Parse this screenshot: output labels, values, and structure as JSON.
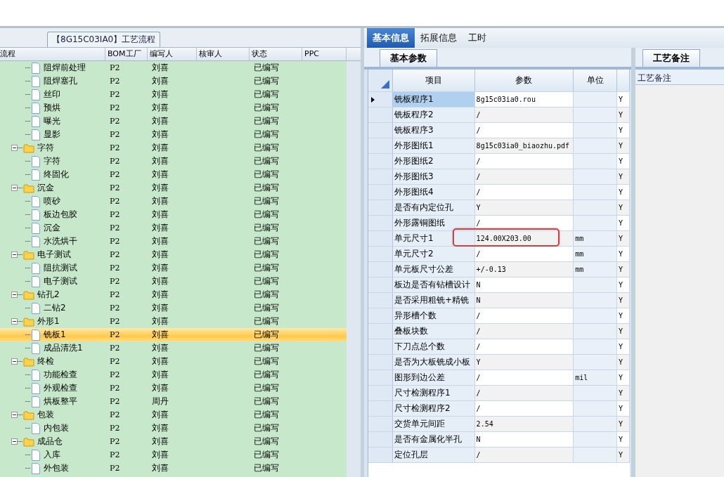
{
  "left_panel": {
    "title": "【8G15C03IA0】工艺流程",
    "columns": [
      "流程",
      "BOM工厂",
      "编写人",
      "核审人",
      "状态",
      "PPC"
    ],
    "rows": [
      {
        "kind": "step",
        "name": "阻焊前处理",
        "bom": "P2",
        "writer": "刘喜",
        "status": "已编写",
        "selected": false
      },
      {
        "kind": "step",
        "name": "阻焊塞孔",
        "bom": "P2",
        "writer": "刘喜",
        "status": "已编写",
        "selected": false
      },
      {
        "kind": "step",
        "name": "丝印",
        "bom": "P2",
        "writer": "刘喜",
        "status": "已编写",
        "selected": false
      },
      {
        "kind": "step",
        "name": "预烘",
        "bom": "P2",
        "writer": "刘喜",
        "status": "已编写",
        "selected": false
      },
      {
        "kind": "step",
        "name": "曝光",
        "bom": "P2",
        "writer": "刘喜",
        "status": "已编写",
        "selected": false
      },
      {
        "kind": "step",
        "name": "显影",
        "bom": "P2",
        "writer": "刘喜",
        "status": "已编写",
        "selected": false
      },
      {
        "kind": "group",
        "name": "字符",
        "bom": "P2",
        "writer": "刘喜",
        "status": "已编写",
        "selected": false,
        "expanded": true,
        "children": [
          {
            "kind": "step",
            "name": "字符",
            "bom": "P2",
            "writer": "刘喜",
            "status": "已编写",
            "selected": false
          },
          {
            "kind": "step",
            "name": "终固化",
            "bom": "P2",
            "writer": "刘喜",
            "status": "已编写",
            "selected": false
          }
        ]
      },
      {
        "kind": "group",
        "name": "沉金",
        "bom": "P2",
        "writer": "刘喜",
        "status": "已编写",
        "selected": false,
        "expanded": true,
        "children": [
          {
            "kind": "step",
            "name": "喷砂",
            "bom": "P2",
            "writer": "刘喜",
            "status": "已编写",
            "selected": false
          },
          {
            "kind": "step",
            "name": "板边包胶",
            "bom": "P2",
            "writer": "刘喜",
            "status": "已编写",
            "selected": false
          },
          {
            "kind": "step",
            "name": "沉金",
            "bom": "P2",
            "writer": "刘喜",
            "status": "已编写",
            "selected": false
          },
          {
            "kind": "step",
            "name": "水洗烘干",
            "bom": "P2",
            "writer": "刘喜",
            "status": "已编写",
            "selected": false
          }
        ]
      },
      {
        "kind": "group",
        "name": "电子测试",
        "bom": "P2",
        "writer": "刘喜",
        "status": "已编写",
        "selected": false,
        "expanded": true,
        "children": [
          {
            "kind": "step",
            "name": "阻抗测试",
            "bom": "P2",
            "writer": "刘喜",
            "status": "已编写",
            "selected": false
          },
          {
            "kind": "step",
            "name": "电子测试",
            "bom": "P2",
            "writer": "刘喜",
            "status": "已编写",
            "selected": false
          }
        ]
      },
      {
        "kind": "group",
        "name": "钻孔2",
        "bom": "P2",
        "writer": "刘喜",
        "status": "已编写",
        "selected": false,
        "expanded": true,
        "children": [
          {
            "kind": "step",
            "name": "二钻2",
            "bom": "P2",
            "writer": "刘喜",
            "status": "已编写",
            "selected": false
          }
        ]
      },
      {
        "kind": "group",
        "name": "外形1",
        "bom": "P2",
        "writer": "刘喜",
        "status": "已编写",
        "selected": false,
        "expanded": true,
        "children": [
          {
            "kind": "step",
            "name": "铣板1",
            "bom": "P2",
            "writer": "刘喜",
            "status": "已编写",
            "selected": true
          },
          {
            "kind": "step",
            "name": "成品清洗1",
            "bom": "P2",
            "writer": "刘喜",
            "status": "已编写",
            "selected": false
          }
        ]
      },
      {
        "kind": "group",
        "name": "终检",
        "bom": "P2",
        "writer": "刘喜",
        "status": "已编写",
        "selected": false,
        "expanded": true,
        "children": [
          {
            "kind": "step",
            "name": "功能检查",
            "bom": "P2",
            "writer": "刘喜",
            "status": "已编写",
            "selected": false
          },
          {
            "kind": "step",
            "name": "外观检查",
            "bom": "P2",
            "writer": "刘喜",
            "status": "已编写",
            "selected": false
          },
          {
            "kind": "step",
            "name": "烘板整平",
            "bom": "P2",
            "writer": "周丹",
            "status": "已编写",
            "selected": false
          }
        ]
      },
      {
        "kind": "group",
        "name": "包装",
        "bom": "P2",
        "writer": "刘喜",
        "status": "已编写",
        "selected": false,
        "expanded": true,
        "children": [
          {
            "kind": "step",
            "name": "内包装",
            "bom": "P2",
            "writer": "刘喜",
            "status": "已编写",
            "selected": false
          }
        ]
      },
      {
        "kind": "group",
        "name": "成品仓",
        "bom": "P2",
        "writer": "刘喜",
        "status": "已编写",
        "selected": false,
        "expanded": true,
        "children": [
          {
            "kind": "step",
            "name": "入库",
            "bom": "P2",
            "writer": "刘喜",
            "status": "已编写",
            "selected": false
          },
          {
            "kind": "step",
            "name": "外包装",
            "bom": "P2",
            "writer": "刘喜",
            "status": "已编写",
            "selected": false
          }
        ]
      }
    ]
  },
  "tabs": [
    {
      "label": "基本信息",
      "selected": true
    },
    {
      "label": "拓展信息",
      "selected": false
    },
    {
      "label": "工时",
      "selected": false
    }
  ],
  "params": {
    "tab": "基本参数",
    "columns": [
      "项目",
      "参数",
      "单位"
    ],
    "rows": [
      {
        "item": "铣板程序1",
        "value": "8g15c03ia0.rou",
        "flag": "Y",
        "selected": true
      },
      {
        "item": "铣板程序2",
        "value": "/",
        "flag": "Y",
        "selected": false
      },
      {
        "item": "铣板程序3",
        "value": "/",
        "flag": "Y",
        "selected": false
      },
      {
        "item": "外形图纸1",
        "value": "8g15c03ia0_biaozhu.pdf",
        "flag": "Y",
        "selected": false
      },
      {
        "item": "外形图纸2",
        "value": "/",
        "flag": "Y",
        "selected": false
      },
      {
        "item": "外形图纸3",
        "value": "/",
        "flag": "Y",
        "selected": false
      },
      {
        "item": "外形图纸4",
        "value": "/",
        "flag": "Y",
        "selected": false
      },
      {
        "item": "是否有内定位孔",
        "value": "Y",
        "flag": "Y",
        "selected": false
      },
      {
        "item": "外形露铜图纸",
        "value": "/",
        "flag": "Y",
        "selected": false
      },
      {
        "item": "单元尺寸1",
        "value": "124.00X203.00",
        "unit": "mm",
        "flag": "Y",
        "selected": false,
        "highlighted": true
      },
      {
        "item": "单元尺寸2",
        "value": "/",
        "unit": "mm",
        "flag": "Y",
        "selected": false
      },
      {
        "item": "单元板尺寸公差",
        "value": "+/-0.13",
        "unit": "mm",
        "flag": "Y",
        "selected": false
      },
      {
        "item": "板边是否有钻槽设计",
        "value": "N",
        "flag": "Y",
        "selected": false
      },
      {
        "item": "是否采用粗铣+精铣",
        "value": "N",
        "flag": "Y",
        "selected": false
      },
      {
        "item": "异形槽个数",
        "value": "/",
        "flag": "Y",
        "selected": false
      },
      {
        "item": "叠板块数",
        "value": "/",
        "flag": "Y",
        "selected": false
      },
      {
        "item": "下刀点总个数",
        "value": "/",
        "flag": "Y",
        "selected": false
      },
      {
        "item": "是否为大板铣成小板",
        "value": "Y",
        "flag": "Y",
        "selected": false
      },
      {
        "item": "图形到边公差",
        "value": "/",
        "unit": "mil",
        "flag": "Y",
        "selected": false
      },
      {
        "item": "尺寸检测程序1",
        "value": "/",
        "flag": "Y",
        "selected": false
      },
      {
        "item": "尺寸检测程序2",
        "value": "/",
        "flag": "Y",
        "selected": false
      },
      {
        "item": "交货单元间距",
        "value": "2.54",
        "flag": "Y",
        "selected": false
      },
      {
        "item": "是否有金属化半孔",
        "value": "N",
        "flag": "Y",
        "selected": false
      },
      {
        "item": "定位孔层",
        "value": "/",
        "flag": "Y",
        "selected": false
      }
    ]
  },
  "notes": {
    "tab": "工艺备注",
    "header": "工艺备注"
  }
}
